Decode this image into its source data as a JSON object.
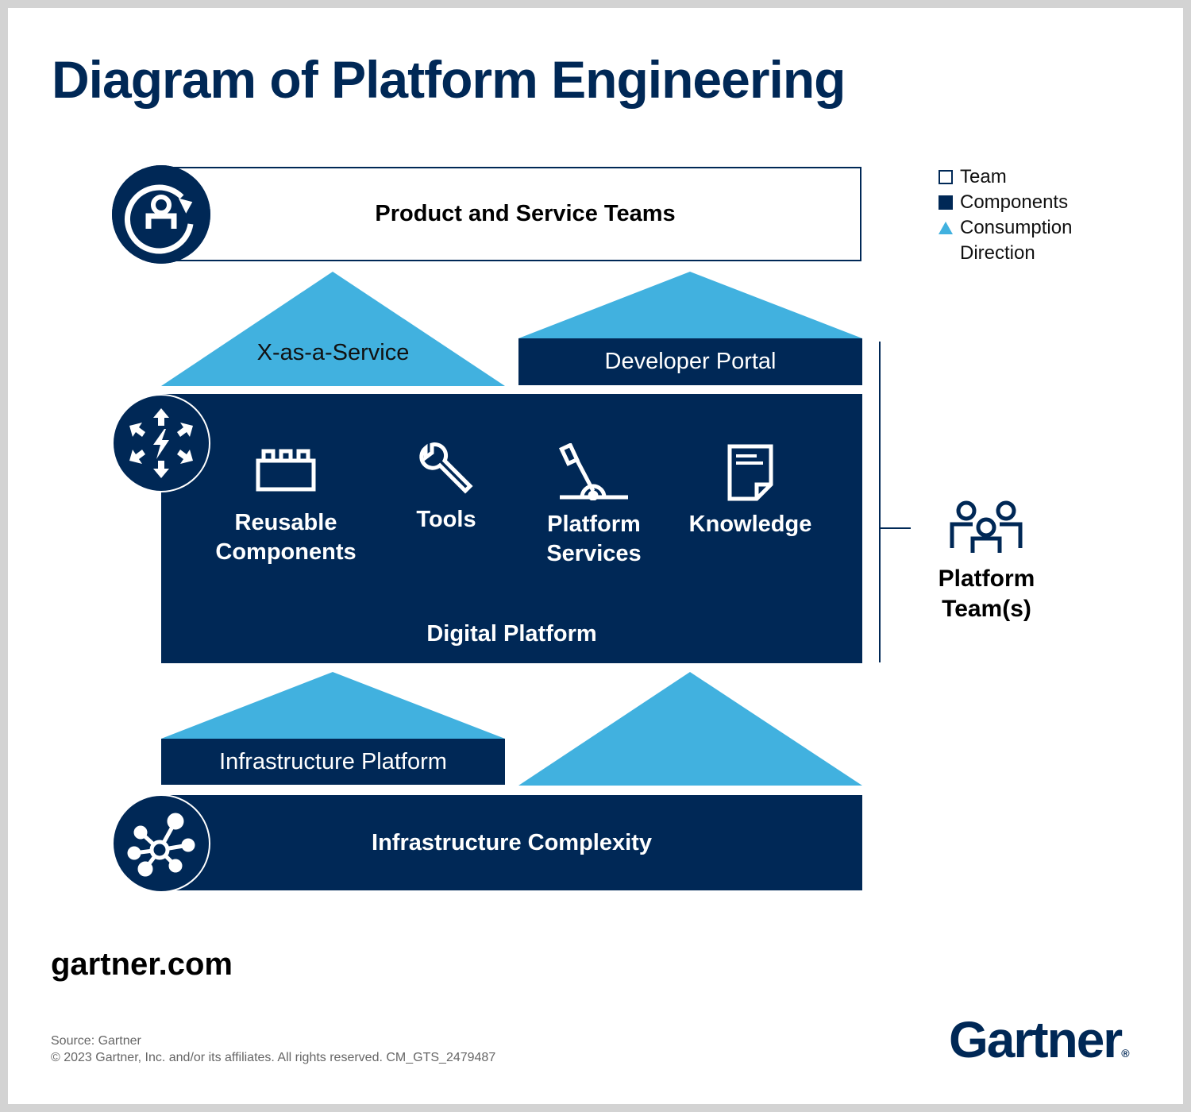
{
  "title": "Diagram of Platform Engineering",
  "colors": {
    "navy": "#002856",
    "light_blue": "#41b1df",
    "white": "#ffffff"
  },
  "team_layer": {
    "label": "Product and Service Teams",
    "icon": "user-cycle-icon"
  },
  "consumption_layer_top": {
    "left_triangle_label": "X-as-a-Service",
    "right_component_label": "Developer Portal"
  },
  "digital_platform": {
    "label": "Digital Platform",
    "icon": "lightning-burst-icon",
    "items": [
      {
        "label_line1": "Reusable",
        "label_line2": "Components",
        "icon": "building-block-icon"
      },
      {
        "label_line1": "Tools",
        "label_line2": "",
        "icon": "wrench-icon"
      },
      {
        "label_line1": "Platform",
        "label_line2": "Services",
        "icon": "lever-icon"
      },
      {
        "label_line1": "Knowledge",
        "label_line2": "",
        "icon": "document-icon"
      }
    ]
  },
  "consumption_layer_bottom": {
    "left_component_label": "Infrastructure Platform"
  },
  "infrastructure": {
    "label": "Infrastructure Complexity",
    "icon": "network-hub-icon"
  },
  "legend": {
    "items": [
      {
        "label": "Team",
        "shape": "outline-square"
      },
      {
        "label": "Components",
        "shape": "filled-square"
      },
      {
        "label": "Consumption",
        "label2": "Direction",
        "shape": "triangle"
      }
    ]
  },
  "platform_team": {
    "label_line1": "Platform",
    "label_line2": "Team(s)",
    "icon": "team-group-icon"
  },
  "footer": {
    "site": "gartner.com",
    "source": "Source: Gartner",
    "copyright": "© 2023 Gartner, Inc. and/or its affiliates. All rights reserved. CM_GTS_2479487",
    "logo": "Gartner",
    "logo_mark": "®"
  }
}
